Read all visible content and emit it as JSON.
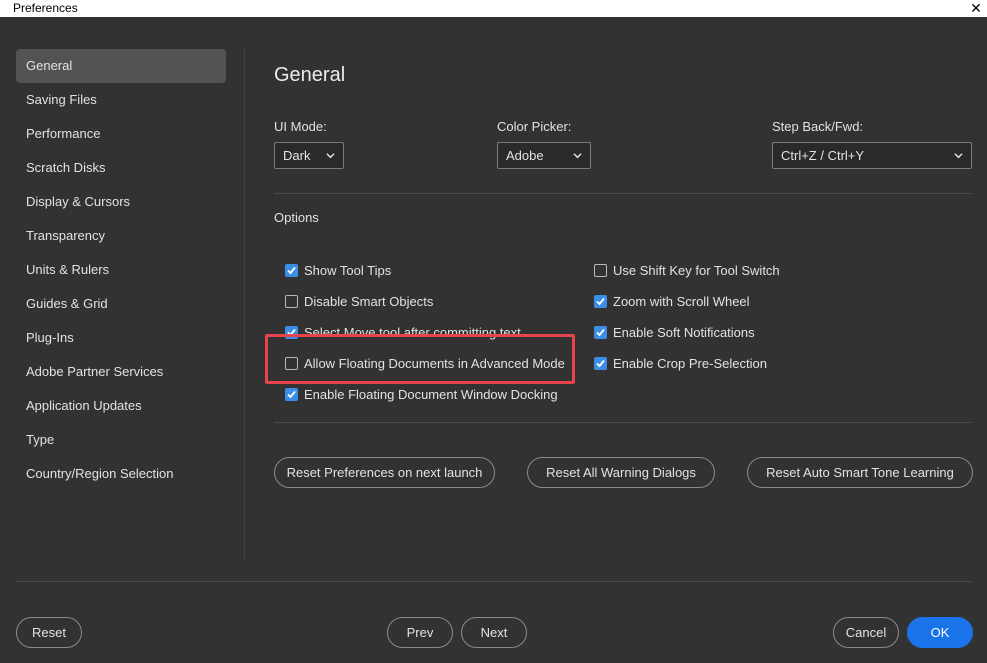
{
  "window": {
    "title": "Preferences",
    "close_glyph": "✕"
  },
  "sidebar": {
    "items": [
      {
        "label": "General",
        "active": true
      },
      {
        "label": "Saving Files"
      },
      {
        "label": "Performance"
      },
      {
        "label": "Scratch Disks"
      },
      {
        "label": "Display & Cursors"
      },
      {
        "label": "Transparency"
      },
      {
        "label": "Units & Rulers"
      },
      {
        "label": "Guides & Grid"
      },
      {
        "label": "Plug-Ins"
      },
      {
        "label": "Adobe Partner Services"
      },
      {
        "label": "Application Updates"
      },
      {
        "label": "Type"
      },
      {
        "label": "Country/Region Selection"
      }
    ]
  },
  "main": {
    "heading": "General",
    "ui_mode": {
      "label": "UI Mode:",
      "value": "Dark"
    },
    "color_picker": {
      "label": "Color Picker:",
      "value": "Adobe"
    },
    "step_back": {
      "label": "Step Back/Fwd:",
      "value": "Ctrl+Z / Ctrl+Y"
    },
    "options_label": "Options",
    "options_left": [
      {
        "label": "Show Tool Tips",
        "checked": true
      },
      {
        "label": "Disable Smart Objects",
        "checked": false
      },
      {
        "label": "Select Move tool after committing text",
        "checked": true
      },
      {
        "label": "Allow Floating Documents in Advanced Mode",
        "checked": false
      },
      {
        "label": "Enable Floating Document Window Docking",
        "checked": true
      }
    ],
    "options_right": [
      {
        "label": "Use Shift Key for Tool Switch",
        "checked": false
      },
      {
        "label": "Zoom with Scroll Wheel",
        "checked": true
      },
      {
        "label": "Enable Soft Notifications",
        "checked": true
      },
      {
        "label": "Enable Crop Pre-Selection",
        "checked": true
      }
    ],
    "buttons": {
      "reset_prefs": "Reset Preferences on next launch",
      "reset_warnings": "Reset All Warning Dialogs",
      "reset_auto_tone": "Reset Auto Smart Tone Learning"
    }
  },
  "footer": {
    "reset": "Reset",
    "prev": "Prev",
    "next": "Next",
    "cancel": "Cancel",
    "ok": "OK"
  },
  "colors": {
    "background": "#323232",
    "checkbox_on": "#3b8ee8",
    "primary_button": "#1a73e8",
    "highlight_box": "#e8424b"
  }
}
